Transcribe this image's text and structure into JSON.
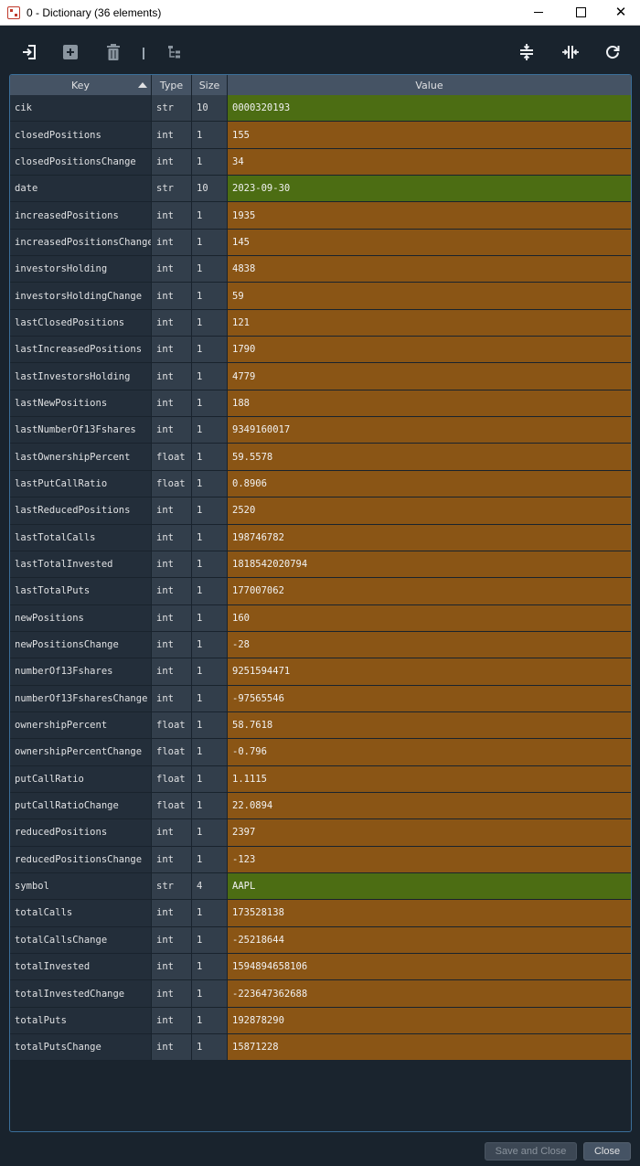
{
  "window": {
    "title": "0 - Dictionary (36 elements)",
    "app_icon": "spyder-icon",
    "controls": [
      "minimize-icon",
      "maximize-icon",
      "close-icon"
    ]
  },
  "toolbar": {
    "left_icons": [
      "import-icon",
      "add-icon",
      "delete-icon",
      "tree-icon"
    ],
    "right_icons": [
      "resize-rows-icon",
      "resize-columns-icon",
      "refresh-icon"
    ]
  },
  "table": {
    "headers": {
      "key": "Key",
      "type": "Type",
      "size": "Size",
      "value": "Value"
    },
    "sort": "Key ascending",
    "colors": {
      "str": "#4c6d13",
      "numeric": "#8a5515"
    },
    "rows": [
      {
        "key": "cik",
        "type": "str",
        "size": "10",
        "value": "0000320193"
      },
      {
        "key": "closedPositions",
        "type": "int",
        "size": "1",
        "value": "155"
      },
      {
        "key": "closedPositionsChange",
        "type": "int",
        "size": "1",
        "value": "34"
      },
      {
        "key": "date",
        "type": "str",
        "size": "10",
        "value": "2023-09-30"
      },
      {
        "key": "increasedPositions",
        "type": "int",
        "size": "1",
        "value": "1935"
      },
      {
        "key": "increasedPositionsChange",
        "type": "int",
        "size": "1",
        "value": "145"
      },
      {
        "key": "investorsHolding",
        "type": "int",
        "size": "1",
        "value": "4838"
      },
      {
        "key": "investorsHoldingChange",
        "type": "int",
        "size": "1",
        "value": "59"
      },
      {
        "key": "lastClosedPositions",
        "type": "int",
        "size": "1",
        "value": "121"
      },
      {
        "key": "lastIncreasedPositions",
        "type": "int",
        "size": "1",
        "value": "1790"
      },
      {
        "key": "lastInvestorsHolding",
        "type": "int",
        "size": "1",
        "value": "4779"
      },
      {
        "key": "lastNewPositions",
        "type": "int",
        "size": "1",
        "value": "188"
      },
      {
        "key": "lastNumberOf13Fshares",
        "type": "int",
        "size": "1",
        "value": "9349160017"
      },
      {
        "key": "lastOwnershipPercent",
        "type": "float",
        "size": "1",
        "value": "59.5578"
      },
      {
        "key": "lastPutCallRatio",
        "type": "float",
        "size": "1",
        "value": "0.8906"
      },
      {
        "key": "lastReducedPositions",
        "type": "int",
        "size": "1",
        "value": "2520"
      },
      {
        "key": "lastTotalCalls",
        "type": "int",
        "size": "1",
        "value": "198746782"
      },
      {
        "key": "lastTotalInvested",
        "type": "int",
        "size": "1",
        "value": "1818542020794"
      },
      {
        "key": "lastTotalPuts",
        "type": "int",
        "size": "1",
        "value": "177007062"
      },
      {
        "key": "newPositions",
        "type": "int",
        "size": "1",
        "value": "160"
      },
      {
        "key": "newPositionsChange",
        "type": "int",
        "size": "1",
        "value": "-28"
      },
      {
        "key": "numberOf13Fshares",
        "type": "int",
        "size": "1",
        "value": "9251594471"
      },
      {
        "key": "numberOf13FsharesChange",
        "type": "int",
        "size": "1",
        "value": "-97565546"
      },
      {
        "key": "ownershipPercent",
        "type": "float",
        "size": "1",
        "value": "58.7618"
      },
      {
        "key": "ownershipPercentChange",
        "type": "float",
        "size": "1",
        "value": "-0.796"
      },
      {
        "key": "putCallRatio",
        "type": "float",
        "size": "1",
        "value": "1.1115"
      },
      {
        "key": "putCallRatioChange",
        "type": "float",
        "size": "1",
        "value": "22.0894"
      },
      {
        "key": "reducedPositions",
        "type": "int",
        "size": "1",
        "value": "2397"
      },
      {
        "key": "reducedPositionsChange",
        "type": "int",
        "size": "1",
        "value": "-123"
      },
      {
        "key": "symbol",
        "type": "str",
        "size": "4",
        "value": "AAPL"
      },
      {
        "key": "totalCalls",
        "type": "int",
        "size": "1",
        "value": "173528138"
      },
      {
        "key": "totalCallsChange",
        "type": "int",
        "size": "1",
        "value": "-25218644"
      },
      {
        "key": "totalInvested",
        "type": "int",
        "size": "1",
        "value": "1594894658106"
      },
      {
        "key": "totalInvestedChange",
        "type": "int",
        "size": "1",
        "value": "-223647362688"
      },
      {
        "key": "totalPuts",
        "type": "int",
        "size": "1",
        "value": "192878290"
      },
      {
        "key": "totalPutsChange",
        "type": "int",
        "size": "1",
        "value": "15871228"
      }
    ]
  },
  "footer": {
    "save_label": "Save and Close",
    "close_label": "Close"
  }
}
